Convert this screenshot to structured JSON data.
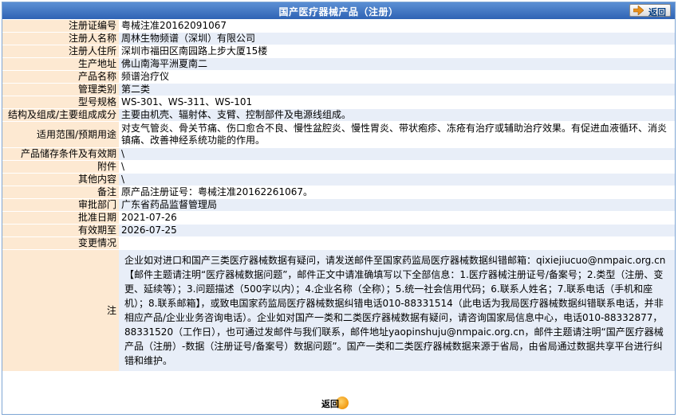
{
  "header": {
    "title": "国产医疗器械产品（注册）",
    "back_label": "返回"
  },
  "fields": [
    {
      "label": "注册证编号",
      "value": "粤械注准20162091067"
    },
    {
      "label": "注册人名称",
      "value": "周林生物频谱（深圳）有限公司"
    },
    {
      "label": "注册人住所",
      "value": "深圳市福田区南园路上步大厦15楼"
    },
    {
      "label": "生产地址",
      "value": "佛山南海平洲夏南二"
    },
    {
      "label": "产品名称",
      "value": "频谱治疗仪"
    },
    {
      "label": "管理类别",
      "value": "第二类"
    },
    {
      "label": "型号规格",
      "value": "WS-301、WS-311、WS-101"
    },
    {
      "label": "结构及组成/主要组成成分",
      "value": "主要由机壳、辐射体、支臂、控制部件及电源线组成。"
    },
    {
      "label": "适用范围/预期用途",
      "value": "对支气管炎、骨关节痛、伤口愈合不良、慢性盆腔炎、慢性胃炎、带状疱疹、冻疮有治疗或辅助治疗效果。有促进血液循环、消炎镇痛、改善神经系统功能的作用。"
    },
    {
      "label": "产品储存条件及有效期",
      "value": "\\"
    },
    {
      "label": "附件",
      "value": "\\"
    },
    {
      "label": "其他内容",
      "value": "\\"
    },
    {
      "label": "备注",
      "value": "原产品注册证号：粤械注准20162261067。"
    },
    {
      "label": "审批部门",
      "value": "广东省药品监督管理局"
    },
    {
      "label": "批准日期",
      "value": "2021-07-26"
    },
    {
      "label": "有效期至",
      "value": "2026-07-25"
    },
    {
      "label": "变更情况",
      "value": ""
    }
  ],
  "note": {
    "label": "注",
    "text": "企业如对进口和国产三类医疗器械数据有疑问，请发送邮件至国家药监局医疗器械数据纠错邮箱：qixiejiucuo@nmpaic.org.cn【邮件主题请注明“医疗器械数据问题”，邮件正文中请准确填写以下全部信息：1.医疗器械注册证号/备案号；2.类型（注册、变更、延续等）；3.问题描述（500字以内）；4.企业名称（全称）；5.统一社会信用代码；6.联系人姓名；7.联系电话（手机和座机）；8.联系邮箱】，或致电国家药监局医疗器械数据纠错电话010-88331514（此电话为我局医疗器械数据纠错联系电话，并非相应产品/企业业务咨询电话）。企业如对国产一类和二类医疗器械数据有疑问，请咨询国家局信息中心，电话010-88332877，88331520（工作日），也可通过发邮件与我们联系，邮件地址yaopinshuju@nmpaic.org.cn，邮件主题请注明“国产医疗器械产品（注册）-数据（注册证号/备案号）数据问题”。国产一类和二类医疗器械数据来源于省局，由省局通过数据共享平台进行纠错和维护。"
  },
  "footer": {
    "back_label": "返回"
  },
  "colors": {
    "title_bar": "#2f63b4",
    "label_bg": "#fde9d2",
    "alt_row_bg": "#e8eef8",
    "back_circle": "#f19a13"
  }
}
